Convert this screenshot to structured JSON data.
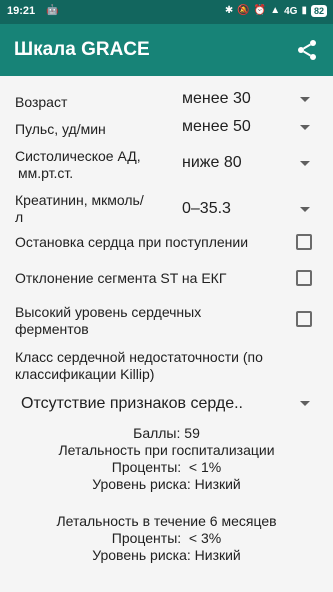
{
  "status_bar": {
    "time": "19:21",
    "network": "4G",
    "battery": "82"
  },
  "app_bar": {
    "title": "Шкала GRACE"
  },
  "fields": [
    {
      "label": "Возраст",
      "value": "менее 30"
    },
    {
      "label": "Пульс, уд/мин",
      "value": "менее 50"
    },
    {
      "label_line1": "Систолическое АД,",
      "label_line2": "мм.рт.ст.",
      "value": "ниже 80"
    },
    {
      "label_line1": "Креатинин, мкмоль/",
      "label_line2": "л",
      "value": "0–35.3"
    }
  ],
  "checks": [
    {
      "label": "Остановка сердца при поступлении",
      "checked": false
    },
    {
      "label": "Отклонение сегмента ST на ЕКГ",
      "checked": false
    },
    {
      "label_line1": "Высокий уровень сердечных",
      "label_line2": "ферментов",
      "checked": false
    }
  ],
  "killip": {
    "label_line1": "Класс сердечной недостаточности (по",
    "label_line2": "классификации Killip)",
    "value": "Отсутствие признаков серде.."
  },
  "results": {
    "score": "Баллы: 59",
    "hospital_title": "Летальность при госпитализации",
    "hospital_percent": "Проценты:  < 1%",
    "hospital_risk": "Уровень риска: Низкий",
    "six_month_title": "Летальность в течение 6 месяцев",
    "six_month_percent": "Проценты:  < 3%",
    "six_month_risk": "Уровень риска: Низкий"
  }
}
